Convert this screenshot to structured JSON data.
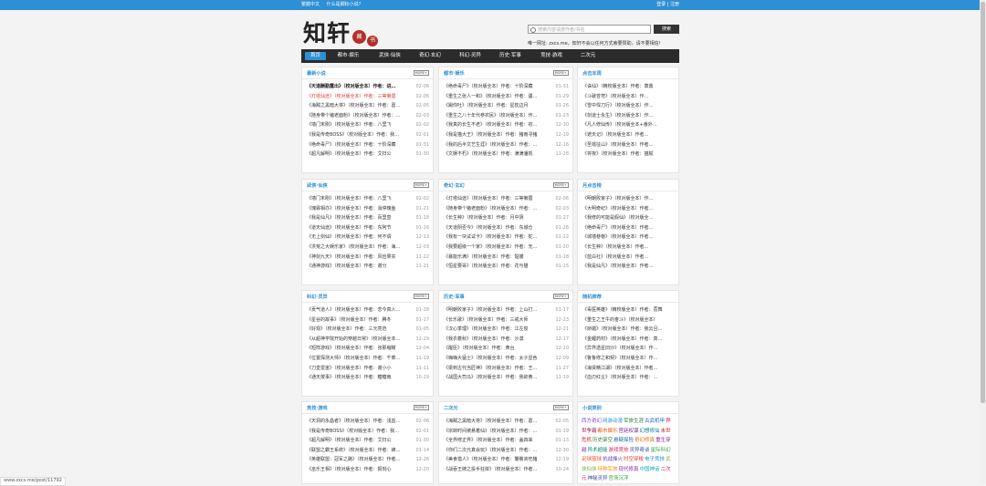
{
  "topbar": {
    "links": [
      "繁體中文",
      "什么是脚标小说?"
    ],
    "login": "登录 | 注册"
  },
  "logo": {
    "ch1": "知",
    "ch2": "轩",
    "seal1": "藏",
    "seal2": "书"
  },
  "search": {
    "placeholder": "搜索内容请按作者/书名",
    "button": "搜索"
  },
  "notice": "唯一网址: zxcs.me，知轩不会以任何方式索要赞助，请不要相信!",
  "nav": [
    "首页",
    "都市·娱乐",
    "武侠·仙侠",
    "奇幻·玄幻",
    "科幻·灵异",
    "历史·军事",
    "竞技·游戏",
    "二次元"
  ],
  "more": "MORE+",
  "panels": [
    {
      "title": "最新小说",
      "rows": [
        {
          "text": "《天道酬勤露出》（校对版全本）作者：进…",
          "date": "02-06",
          "style": "bold"
        },
        {
          "text": "《灯塔仙途》（校对版全本）作者：三等懒眉",
          "date": "02-06",
          "style": "hl"
        },
        {
          "text": "《海贼之黑暗大将》（校对版全本）作者：葛…",
          "date": "02-05"
        },
        {
          "text": "《随身带个猪老面粉》（校对版全本）作者：…",
          "date": "02-03"
        },
        {
          "text": "《墙门末刚》（校对版全本）作者：八里飞",
          "date": "02-02"
        },
        {
          "text": "《我是传奇BOSS》（校对版全本）作者：我…",
          "date": "02-01"
        },
        {
          "text": "《绝命毒尸》（校对版全本）作者：十阶深藏",
          "date": "01-31"
        },
        {
          "text": "《超凡解明》（校对版全本）作者：艾扫公",
          "date": "01-30"
        }
      ]
    },
    {
      "title": "都市·娱乐",
      "rows": [
        {
          "text": "《绝命毒尸》（校对版全本）作者：十阶深藏",
          "date": "01-31"
        },
        {
          "text": "《重生之张人一和》（校对版全本）作者：疆…",
          "date": "01-29"
        },
        {
          "text": "《踢你吐》（校对版全本）作者：星枕边月",
          "date": "01-26"
        },
        {
          "text": "《重生之八十年代参农民》（校对版全本）作…",
          "date": "01-23"
        },
        {
          "text": "《我真的长生不老》（校对版全本）作者：初…",
          "date": "12-30"
        },
        {
          "text": "《我是猫大王》（校对版全本）作者：猪南寻猪",
          "date": "12-19"
        },
        {
          "text": "《我的后半文艺生涯》（校对版全本）作者：…",
          "date": "12-16"
        },
        {
          "text": "《文娱不朽》（校对版全本）作者：满满潘凯",
          "date": "11-28"
        }
      ]
    },
    {
      "title": "武侠·仙侠",
      "rows": [
        {
          "text": "《墙门末刚》（校对版全本）作者：八里飞",
          "date": "02-02"
        },
        {
          "text": "《瑰霖相亦》（校对版全本）作者：消停瑰鱼",
          "date": "01-21"
        },
        {
          "text": "《我是仙凡》（校对版全本）作者：百里皇",
          "date": "01-18"
        },
        {
          "text": "《道天仙途》（校对版全本）作者：东阿节",
          "date": "01-16"
        },
        {
          "text": "《无上剑仙》（校对版全本）作者：何不谓",
          "date": "12-13"
        },
        {
          "text": "《洪荒之大娱乐家》（校对版全本）作者：海…",
          "date": "12-03"
        },
        {
          "text": "《神剑九天》（校对版全本）作者：风俭果实",
          "date": "11-22"
        },
        {
          "text": "《通神游戏》（校对版全本）作者：谢分",
          "date": "11-21"
        }
      ]
    },
    {
      "title": "奇幻·玄幻",
      "rows": [
        {
          "text": "《灯塔仙途》（校对版全本）作者：三等懒眉",
          "date": "02-06"
        },
        {
          "text": "《随身带个猪老面粉》（校对版全本）作者：…",
          "date": "02-03"
        },
        {
          "text": "《长生种》（校对版全本）作者：月中阴",
          "date": "01-27"
        },
        {
          "text": "《天道阴否今》（校对版全本）作者：东城仓",
          "date": "01-26"
        },
        {
          "text": "《我有一块试试卡》（校对版全本）作者：蛇…",
          "date": "01-22"
        },
        {
          "text": "《我要超级一个家》（校对版全本）作者：无…",
          "date": "01-20"
        },
        {
          "text": "《暴能乐满》（校对版全本）作者：骷髅",
          "date": "01-18"
        },
        {
          "text": "《恒星要哥》（校对版全本）作者：花与猫",
          "date": "01-15"
        }
      ]
    },
    {
      "title": "科幻·灵异",
      "rows": [
        {
          "text": "《贡气道人》（校对版全本）作者：念今真人…",
          "date": "01-28"
        },
        {
          "text": "《星谷的故事》（校对版全本）作者：腾冬",
          "date": "01-17"
        },
        {
          "text": "《好观》（校对版全本）作者：三元亮范",
          "date": "01-05"
        },
        {
          "text": "《从超神学院开始的穿越日常》（校对版全本…",
          "date": "12-29"
        },
        {
          "text": "《短阵游戏》（校对版全本）作者：张那缩瞳",
          "date": "12-04"
        },
        {
          "text": "《位置探测大师》（校对版全本）作者：千菜…",
          "date": "11-19"
        },
        {
          "text": "《刀皇雷宙》（校对版全本）作者：谢小小",
          "date": "11-11"
        },
        {
          "text": "《通天按事》（校对版全本）作者：糖糖南",
          "date": "10-29"
        }
      ]
    },
    {
      "title": "历史·军事",
      "rows": [
        {
          "text": "《明朝败家子》（校对版全本）作者：上山打…",
          "date": "01-17"
        },
        {
          "text": "《长乐歌》（校对版全本）作者：三戒大师",
          "date": "12-23"
        },
        {
          "text": "《汉心季理》（校对版全本）作者：江左俊",
          "date": "12-21"
        },
        {
          "text": "《我衣着秋》（校对版全本）作者：沙漠",
          "date": "12-17"
        },
        {
          "text": "《醒臣》（校对版全本）作者：黄台",
          "date": "12-10"
        },
        {
          "text": "《嗨嗨大猛士》（校对版全本）作者：太子显色",
          "date": "12-09"
        },
        {
          "text": "《梁到古代当匠神》（校对版全本）作者：王…",
          "date": "11-27"
        },
        {
          "text": "《战国大司马》（校对版全本）作者：我欲黄…",
          "date": "11-19"
        }
      ]
    },
    {
      "title": "竞技·游戏",
      "rows": [
        {
          "text": "《天洞的永昌者》（校对版全本）作者：浅血…",
          "date": "02-06"
        },
        {
          "text": "《我是传奇BOSS》（校对版全本）作者：我…",
          "date": "02-01"
        },
        {
          "text": "《超凡解明》（校对版全本）作者：艾扫公",
          "date": "01-30"
        },
        {
          "text": "《联盟之霸王系统》（校对版全本）作者：蜂…",
          "date": "01-14"
        },
        {
          "text": "《英雄联盟：冠军之路》（校对版全本）作者…",
          "date": "12-26"
        },
        {
          "text": "《巫乐王相》（校对版全本）作者：报刻心",
          "date": "12-20"
        }
      ]
    },
    {
      "title": "二次元",
      "rows": [
        {
          "text": "《海贼之黑暗大将》（校对版全本）作者：葛…",
          "date": "02-05"
        },
        {
          "text": "《宗转时间被悬着仙》（校对版全本）作者：…",
          "date": "01-19"
        },
        {
          "text": "《全界修正界》（校对版全本）作者：盖四来",
          "date": "01-13"
        },
        {
          "text": "《你们二次元真会玩》（校对版全本）作者：…",
          "date": "12-30"
        },
        {
          "text": "《美食猎人》（校对版全本）作者：饕餮贪吃猪",
          "date": "12-19"
        },
        {
          "text": "《战吞王牌之投手狂岸》（校对版全本）作者…",
          "date": "10-24"
        }
      ]
    },
    {
      "title": "点击本周",
      "rows": [
        {
          "text": "《诛仙》（精校版全本）作者：萧鼎"
        },
        {
          "text": "《斗破苍穹》（校对版全本）作…"
        },
        {
          "text": "《雪中悍刀行》（校对版全本）作…"
        },
        {
          "text": "《剑道士永生》（校对版全本）作…"
        },
        {
          "text": "《凡人修仙传》（校对版全本+番外…"
        },
        {
          "text": "《遮天记》（校对版全本）作者…"
        },
        {
          "text": "《圣墟征山》（校对版全本）作者…"
        },
        {
          "text": "《将夜》（校对版全本）作者：猫腻"
        }
      ]
    },
    {
      "title": "月点击榜",
      "rows": [
        {
          "text": "《明朝败家子》（校对版全本）作…"
        },
        {
          "text": "《大明奇纪》（校对版全本）作者…"
        },
        {
          "text": "《我修的可能是假仙》（校对版全…"
        },
        {
          "text": "《绝命毒尸》（校对版全本）作者…"
        },
        {
          "text": "《城墙巷巷》（校对版全本）作者…"
        },
        {
          "text": "《长生种》（校对版全本）作者…"
        },
        {
          "text": "《蓝白社》（校对版全本）作者…"
        },
        {
          "text": "《我是仙凡》（校对版全本）作者…"
        }
      ]
    },
    {
      "title": "随机推荐",
      "rows": [
        {
          "text": "《毒医英雄》（精校版全本）作者：荔舞"
        },
        {
          "text": "《重生之王牛的奋斗》（校对版全本）"
        },
        {
          "text": "《娇媚》（校对版全本）作者：我云且…"
        },
        {
          "text": "《金鲤药材》（校对版全本）作者：真…"
        },
        {
          "text": "《异界透星旧沙》（校对版全本）作…"
        },
        {
          "text": "《鲁鲁修之和契》（校对版全本）作…"
        },
        {
          "text": "《海贤精江湖》（校对版全本）作者…"
        },
        {
          "text": "《血刃红尘》（校对版全本）作者：…"
        }
      ]
    },
    {
      "title": "小说类别",
      "tags": [
        {
          "t": "西方奇幻",
          "c": "#8a4bd6"
        },
        {
          "t": "网游动漫",
          "c": "#2d8fd5"
        },
        {
          "t": "军旅生涯",
          "c": "#2e7d32"
        },
        {
          "t": "古武机甲",
          "c": "#1565c0"
        },
        {
          "t": "异世争霸",
          "c": "#ad1457"
        },
        {
          "t": "都市娱乐",
          "c": "#e65100"
        },
        {
          "t": "宫廷权谋",
          "c": "#6a1b9a"
        },
        {
          "t": "幻想修仙",
          "c": "#00838f"
        },
        {
          "t": "末世危机",
          "c": "#c62828"
        },
        {
          "t": "历史架空",
          "c": "#2e7d32"
        },
        {
          "t": "悬疑探险",
          "c": "#1565c0"
        },
        {
          "t": "奇幻修真",
          "c": "#ef6c00"
        },
        {
          "t": "重生穿越",
          "c": "#8e24aa"
        },
        {
          "t": "异术超能",
          "c": "#00897b"
        },
        {
          "t": "游戏竞技",
          "c": "#d81b60"
        },
        {
          "t": "灵异奇谈",
          "c": "#3949ab"
        },
        {
          "t": "星际科幻",
          "c": "#43a047"
        },
        {
          "t": "足球篮球",
          "c": "#f4511e"
        },
        {
          "t": "抗战烽火",
          "c": "#5e35b1"
        },
        {
          "t": "时空穿梭",
          "c": "#e53935"
        },
        {
          "t": "电子竞技",
          "c": "#1e88e5"
        },
        {
          "t": "武侠仙侠",
          "c": "#7cb342"
        },
        {
          "t": "特种军旅",
          "c": "#fb8c00"
        },
        {
          "t": "现代修真",
          "c": "#8e24aa"
        },
        {
          "t": "中国神话",
          "c": "#00acc1"
        },
        {
          "t": "二次元",
          "c": "#d81b60"
        },
        {
          "t": "神秘灵异",
          "c": "#3949ab"
        },
        {
          "t": "官场沉浮",
          "c": "#43a047"
        }
      ]
    }
  ],
  "status": "www.zxcs.me/post/11792"
}
